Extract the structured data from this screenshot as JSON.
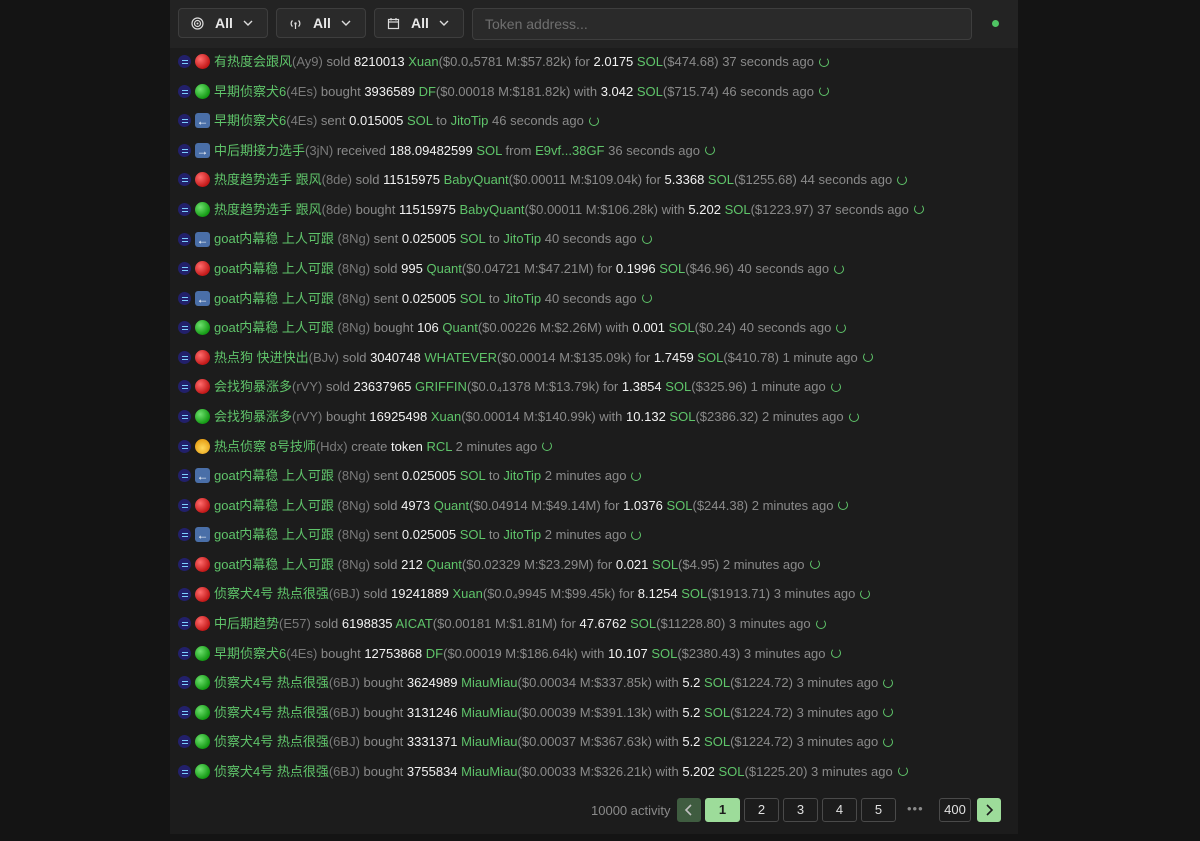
{
  "filters": {
    "type_label": "All",
    "chain_label": "All",
    "date_label": "All",
    "token_placeholder": "Token address..."
  },
  "rows": [
    {
      "icon": "sell",
      "wallet": "有热度会跟风",
      "short": "(Ay9)",
      "verb": "sold",
      "amount": "8210013",
      "token": "Xuan",
      "info": "($0.0₄5781 M:$57.82k)",
      "conj": "for",
      "value": "2.0175",
      "unit": "SOL",
      "usd": "($474.68)",
      "time": "37 seconds ago"
    },
    {
      "icon": "buy",
      "wallet": "早期侦察犬6",
      "short": "(4Es)",
      "verb": "bought",
      "amount": "3936589",
      "token": "DF",
      "info": "($0.00018 M:$181.82k)",
      "conj": "with",
      "value": "3.042",
      "unit": "SOL",
      "usd": "($715.74)",
      "time": "46 seconds ago"
    },
    {
      "icon": "send",
      "wallet": "早期侦察犬6",
      "short": "(4Es)",
      "verb": "sent",
      "amount": "0.015005",
      "token": "SOL",
      "info": "",
      "conj": "to",
      "value": "",
      "unit": "JitoTip",
      "usd": "",
      "time": "46 seconds ago"
    },
    {
      "icon": "recv",
      "wallet": "中后期接力选手",
      "short": "(3jN)",
      "verb": "received",
      "amount": "188.09482599",
      "token": "SOL",
      "info": "",
      "conj": "from",
      "value": "",
      "unit": "E9vf...38GF",
      "usd": "",
      "time": "36 seconds ago"
    },
    {
      "icon": "sell",
      "wallet": "热度趋势选手 跟风",
      "short": "(8de)",
      "verb": "sold",
      "amount": "11515975",
      "token": "BabyQuant",
      "info": "($0.00011 M:$109.04k)",
      "conj": "for",
      "value": "5.3368",
      "unit": "SOL",
      "usd": "($1255.68)",
      "time": "44 seconds ago"
    },
    {
      "icon": "buy",
      "wallet": "热度趋势选手 跟风",
      "short": "(8de)",
      "verb": "bought",
      "amount": "11515975",
      "token": "BabyQuant",
      "info": "($0.00011 M:$106.28k)",
      "conj": "with",
      "value": "5.202",
      "unit": "SOL",
      "usd": "($1223.97)",
      "time": "37 seconds ago"
    },
    {
      "icon": "send",
      "wallet": "goat内幕稳 上人可跟",
      "short": " (8Ng)",
      "verb": "sent",
      "amount": "0.025005",
      "token": "SOL",
      "info": "",
      "conj": "to",
      "value": "",
      "unit": "JitoTip",
      "usd": "",
      "time": "40 seconds ago"
    },
    {
      "icon": "sell",
      "wallet": "goat内幕稳 上人可跟",
      "short": " (8Ng)",
      "verb": "sold",
      "amount": "995",
      "token": "Quant",
      "info": "($0.04721 M:$47.21M)",
      "conj": "for",
      "value": "0.1996",
      "unit": "SOL",
      "usd": "($46.96)",
      "time": "40 seconds ago"
    },
    {
      "icon": "send",
      "wallet": "goat内幕稳 上人可跟",
      "short": " (8Ng)",
      "verb": "sent",
      "amount": "0.025005",
      "token": "SOL",
      "info": "",
      "conj": "to",
      "value": "",
      "unit": "JitoTip",
      "usd": "",
      "time": "40 seconds ago"
    },
    {
      "icon": "buy",
      "wallet": "goat内幕稳 上人可跟",
      "short": " (8Ng)",
      "verb": "bought",
      "amount": "106",
      "token": "Quant",
      "info": "($0.00226 M:$2.26M)",
      "conj": "with",
      "value": "0.001",
      "unit": "SOL",
      "usd": "($0.24)",
      "time": "40 seconds ago"
    },
    {
      "icon": "sell",
      "wallet": "热点狗 快进快出",
      "short": "(BJv)",
      "verb": "sold",
      "amount": "3040748",
      "token": "WHATEVER",
      "info": "($0.00014 M:$135.09k)",
      "conj": "for",
      "value": "1.7459",
      "unit": "SOL",
      "usd": "($410.78)",
      "time": "1 minute ago"
    },
    {
      "icon": "sell",
      "wallet": "会找狗暴涨多",
      "short": "(rVY)",
      "verb": "sold",
      "amount": "23637965",
      "token": "GRIFFIN",
      "info": "($0.0₄1378 M:$13.79k)",
      "conj": "for",
      "value": "1.3854",
      "unit": "SOL",
      "usd": "($325.96)",
      "time": "1 minute ago"
    },
    {
      "icon": "buy",
      "wallet": "会找狗暴涨多",
      "short": "(rVY)",
      "verb": "bought",
      "amount": "16925498",
      "token": "Xuan",
      "info": "($0.00014 M:$140.99k)",
      "conj": "with",
      "value": "10.132",
      "unit": "SOL",
      "usd": "($2386.32)",
      "time": "2 minutes ago"
    },
    {
      "icon": "create",
      "wallet": "热点侦察 8号技师",
      "short": "(Hdx)",
      "verb": "create",
      "amount": "token",
      "token": "RCL",
      "info": "",
      "conj": "",
      "value": "",
      "unit": "",
      "usd": "",
      "time": "2 minutes ago"
    },
    {
      "icon": "send",
      "wallet": "goat内幕稳 上人可跟",
      "short": " (8Ng)",
      "verb": "sent",
      "amount": "0.025005",
      "token": "SOL",
      "info": "",
      "conj": "to",
      "value": "",
      "unit": "JitoTip",
      "usd": "",
      "time": "2 minutes ago"
    },
    {
      "icon": "sell",
      "wallet": "goat内幕稳 上人可跟",
      "short": " (8Ng)",
      "verb": "sold",
      "amount": "4973",
      "token": "Quant",
      "info": "($0.04914 M:$49.14M)",
      "conj": "for",
      "value": "1.0376",
      "unit": "SOL",
      "usd": "($244.38)",
      "time": "2 minutes ago"
    },
    {
      "icon": "send",
      "wallet": "goat内幕稳 上人可跟",
      "short": " (8Ng)",
      "verb": "sent",
      "amount": "0.025005",
      "token": "SOL",
      "info": "",
      "conj": "to",
      "value": "",
      "unit": "JitoTip",
      "usd": "",
      "time": "2 minutes ago"
    },
    {
      "icon": "sell",
      "wallet": "goat内幕稳 上人可跟",
      "short": " (8Ng)",
      "verb": "sold",
      "amount": "212",
      "token": "Quant",
      "info": "($0.02329 M:$23.29M)",
      "conj": "for",
      "value": "0.021",
      "unit": "SOL",
      "usd": "($4.95)",
      "time": "2 minutes ago"
    },
    {
      "icon": "sell",
      "wallet": "侦察犬4号  热点很强",
      "short": "(6BJ)",
      "verb": "sold",
      "amount": "19241889",
      "token": "Xuan",
      "info": "($0.0₄9945 M:$99.45k)",
      "conj": "for",
      "value": "8.1254",
      "unit": "SOL",
      "usd": "($1913.71)",
      "time": "3 minutes ago"
    },
    {
      "icon": "sell",
      "wallet": "中后期趋势",
      "short": "(E57)",
      "verb": "sold",
      "amount": "6198835",
      "token": "AICAT",
      "info": "($0.00181 M:$1.81M)",
      "conj": "for",
      "value": "47.6762",
      "unit": "SOL",
      "usd": "($11228.80)",
      "time": "3 minutes ago"
    },
    {
      "icon": "buy",
      "wallet": "早期侦察犬6",
      "short": "(4Es)",
      "verb": "bought",
      "amount": "12753868",
      "token": "DF",
      "info": "($0.00019 M:$186.64k)",
      "conj": "with",
      "value": "10.107",
      "unit": "SOL",
      "usd": "($2380.43)",
      "time": "3 minutes ago"
    },
    {
      "icon": "buy",
      "wallet": "侦察犬4号  热点很强",
      "short": "(6BJ)",
      "verb": "bought",
      "amount": "3624989",
      "token": "MiauMiau",
      "info": "($0.00034 M:$337.85k)",
      "conj": "with",
      "value": "5.2",
      "unit": "SOL",
      "usd": "($1224.72)",
      "time": "3 minutes ago"
    },
    {
      "icon": "buy",
      "wallet": "侦察犬4号  热点很强",
      "short": "(6BJ)",
      "verb": "bought",
      "amount": "3131246",
      "token": "MiauMiau",
      "info": "($0.00039 M:$391.13k)",
      "conj": "with",
      "value": "5.2",
      "unit": "SOL",
      "usd": "($1224.72)",
      "time": "3 minutes ago"
    },
    {
      "icon": "buy",
      "wallet": "侦察犬4号  热点很强",
      "short": "(6BJ)",
      "verb": "bought",
      "amount": "3331371",
      "token": "MiauMiau",
      "info": "($0.00037 M:$367.63k)",
      "conj": "with",
      "value": "5.2",
      "unit": "SOL",
      "usd": "($1224.72)",
      "time": "3 minutes ago"
    },
    {
      "icon": "buy",
      "wallet": "侦察犬4号  热点很强",
      "short": "(6BJ)",
      "verb": "bought",
      "amount": "3755834",
      "token": "MiauMiau",
      "info": "($0.00033 M:$326.21k)",
      "conj": "with",
      "value": "5.202",
      "unit": "SOL",
      "usd": "($1225.20)",
      "time": "3 minutes ago"
    }
  ],
  "pagination": {
    "count_label": "10000 activity",
    "pages": [
      "1",
      "2",
      "3",
      "4",
      "5"
    ],
    "ellipsis": "•••",
    "last_page": "400",
    "current": "1"
  }
}
